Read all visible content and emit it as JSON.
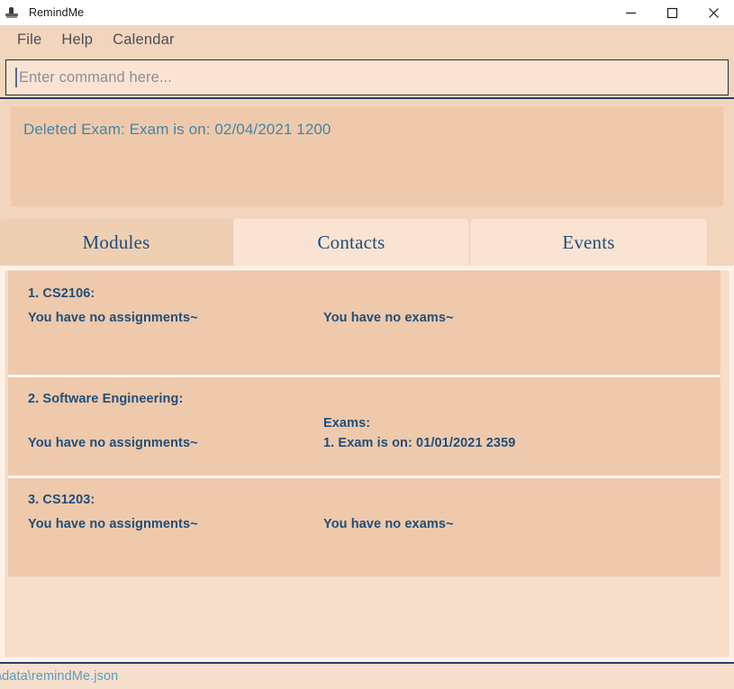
{
  "window": {
    "title": "RemindMe",
    "icon": "app-icon",
    "controls": {
      "minimize": "minimize-icon",
      "maximize": "maximize-icon",
      "close": "close-icon"
    }
  },
  "menu": {
    "items": [
      {
        "label": "File"
      },
      {
        "label": "Help"
      },
      {
        "label": "Calendar"
      }
    ]
  },
  "command": {
    "placeholder": "Enter command here...",
    "value": ""
  },
  "result": {
    "text": "Deleted Exam: Exam is on: 02/04/2021 1200"
  },
  "tabs": [
    {
      "label": "Modules",
      "selected": true
    },
    {
      "label": "Contacts",
      "selected": false
    },
    {
      "label": "Events",
      "selected": false
    }
  ],
  "modules": [
    {
      "title": "1. CS2106:",
      "assignments_heading": "",
      "assignments": "You have no assignments~",
      "exams_heading": "",
      "exams": "You have no exams~"
    },
    {
      "title": "2. Software Engineering:",
      "assignments_heading": "",
      "assignments": "You have no assignments~",
      "exams_heading": "Exams:",
      "exams": "1. Exam is on: 01/01/2021 2359"
    },
    {
      "title": "3. CS1203:",
      "assignments_heading": "",
      "assignments": "You have no assignments~",
      "exams_heading": "",
      "exams": "You have no exams~"
    }
  ],
  "status": {
    "file_path": "\\data\\remindMe.json"
  },
  "colors": {
    "window_bg": "#f2d5bd",
    "card_bg": "#efc9ac",
    "tab_selected": "#efcfb2",
    "tab_unselected": "#fae3d2",
    "text_navy": "#1f4e79",
    "text_teal": "#4186a6",
    "divider_navy": "#2c3e66"
  }
}
